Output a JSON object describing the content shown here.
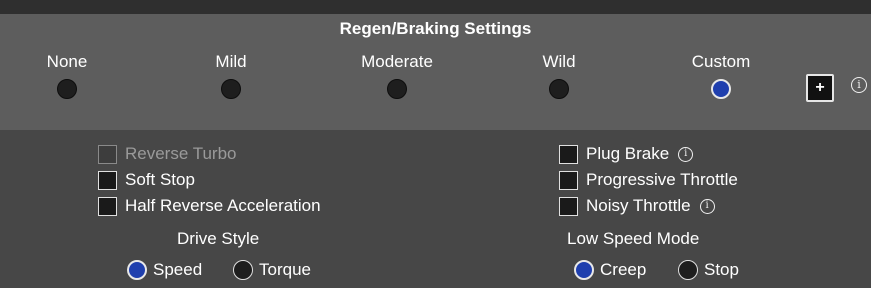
{
  "regen": {
    "title": "Regen/Braking Settings",
    "levels": [
      {
        "label": "None",
        "checked": false
      },
      {
        "label": "Mild",
        "checked": false
      },
      {
        "label": "Moderate",
        "checked": false
      },
      {
        "label": "Wild",
        "checked": false
      },
      {
        "label": "Custom",
        "checked": true
      }
    ],
    "add_label": "+",
    "info_glyph": "i"
  },
  "options": {
    "left": [
      {
        "label": "Reverse Turbo",
        "checked": false,
        "disabled": true
      },
      {
        "label": "Soft Stop",
        "checked": false,
        "disabled": false
      },
      {
        "label": "Half Reverse Acceleration",
        "checked": false,
        "disabled": false
      }
    ],
    "right": [
      {
        "label": "Plug Brake",
        "checked": false,
        "has_info": true
      },
      {
        "label": "Progressive Throttle",
        "checked": false,
        "has_info": false
      },
      {
        "label": "Noisy Throttle",
        "checked": false,
        "has_info": true
      }
    ]
  },
  "drive_style": {
    "title": "Drive Style",
    "options": [
      {
        "label": "Speed",
        "checked": true
      },
      {
        "label": "Torque",
        "checked": false
      }
    ]
  },
  "low_speed_mode": {
    "title": "Low Speed Mode",
    "options": [
      {
        "label": "Creep",
        "checked": true
      },
      {
        "label": "Stop",
        "checked": false
      }
    ]
  },
  "colors": {
    "header_bg": "#5d5d5d",
    "panel_bg": "#474747",
    "accent_selected": "#1f3fae"
  }
}
